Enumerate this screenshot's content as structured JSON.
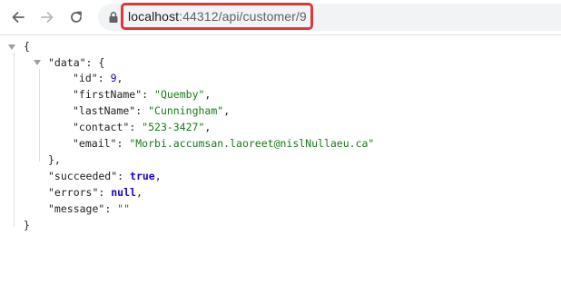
{
  "browser": {
    "url_host": "localhost",
    "url_path": ":44312/api/customer/9",
    "back_icon": "arrow-left-icon",
    "forward_icon": "arrow-right-icon",
    "reload_icon": "reload-icon",
    "lock_icon": "lock-icon"
  },
  "json_view": {
    "open_brace": "{",
    "data_key": "\"data\"",
    "data_open": ": {",
    "id_key": "\"id\"",
    "id_value": "9",
    "firstName_key": "\"firstName\"",
    "firstName_value": "\"Quemby\"",
    "lastName_key": "\"lastName\"",
    "lastName_value": "\"Cunningham\"",
    "contact_key": "\"contact\"",
    "contact_value": "\"523-3427\"",
    "email_key": "\"email\"",
    "email_value": "\"Morbi.accumsan.laoreet@nislNullaeu.ca\"",
    "data_close": "},",
    "succeeded_key": "\"succeeded\"",
    "succeeded_value": "true",
    "errors_key": "\"errors\"",
    "errors_value": "null",
    "message_key": "\"message\"",
    "message_value": "\"\"",
    "close_brace": "}"
  },
  "colors": {
    "highlight_border": "#d93a3a",
    "string_color": "#1a7a1a",
    "literal_color": "#1c00cf"
  }
}
